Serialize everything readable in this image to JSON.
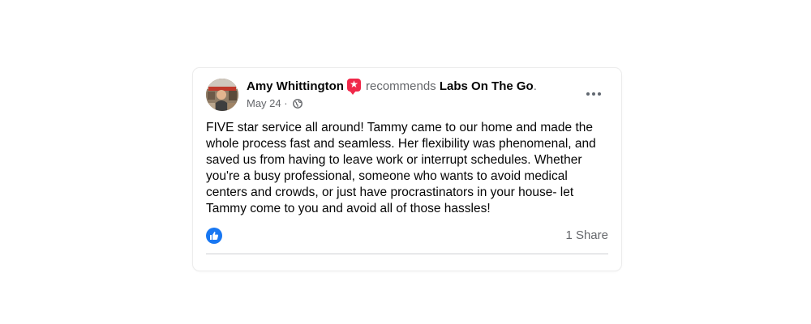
{
  "post": {
    "author": "Amy Whittington",
    "action_text": "recommends",
    "page_name": "Labs On The Go",
    "period": ".",
    "date": "May 24",
    "separator": " · ",
    "privacy_icon": "globe-icon",
    "body": "FIVE star service all around! Tammy came to our home and made the\nwhole process fast and seamless. Her flexibility was phenomenal, and\nsaved us from having to leave work or interrupt schedules. Whether\nyou're a busy professional, someone who wants to avoid medical\ncenters and crowds, or just have procrastinators in your house- let\nTammy come to you and avoid all of those hassles!",
    "share_count": "1 Share"
  },
  "colors": {
    "accent": "#1877f2",
    "recommend_badge": "#f02849",
    "secondary_text": "#65676b",
    "primary_text": "#050505"
  }
}
